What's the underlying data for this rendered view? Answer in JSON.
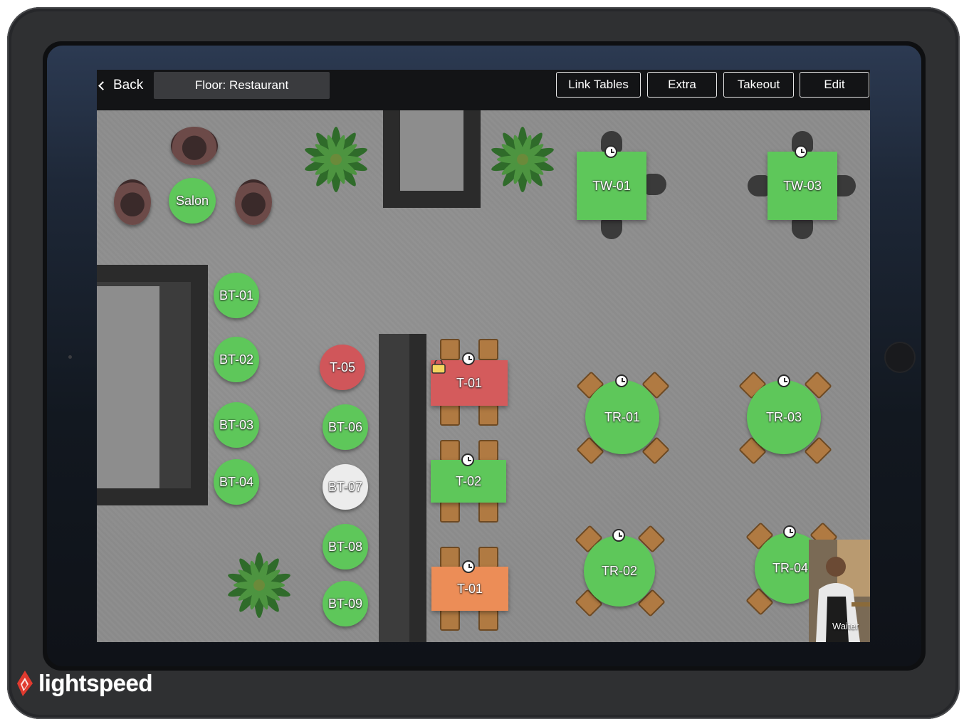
{
  "topbar": {
    "back_label": "Back",
    "floor_label": "Floor: Restaurant",
    "buttons": [
      "Link Tables",
      "Extra",
      "Takeout",
      "Edit"
    ]
  },
  "tables": {
    "salon": "Salon",
    "bt01": "BT-01",
    "bt02": "BT-02",
    "bt03": "BT-03",
    "bt04": "BT-04",
    "t05": "T-05",
    "bt06": "BT-06",
    "bt07": "BT-07",
    "bt08": "BT-08",
    "bt09": "BT-09",
    "t01_top": "T-01",
    "t02": "T-02",
    "t01_bottom": "T-01",
    "tw01": "TW-01",
    "tw03": "TW-03",
    "tr01": "TR-01",
    "tr03": "TR-03",
    "tr02": "TR-02",
    "tr04": "TR-04"
  },
  "overlay": {
    "waiter_label": "Waiter"
  },
  "brand": {
    "logo_text": "lightspeed",
    "logo_color": "#e03a2f"
  },
  "colors": {
    "table_free": "#5ec75a",
    "table_occupied": "#d0565a",
    "table_billing": "#ec8d57",
    "table_inactive": "#ececec"
  },
  "icons": [
    "chevron-left-icon",
    "chevron-right-icon",
    "clock-icon",
    "reserved-icon",
    "lightspeed-flame-icon"
  ]
}
